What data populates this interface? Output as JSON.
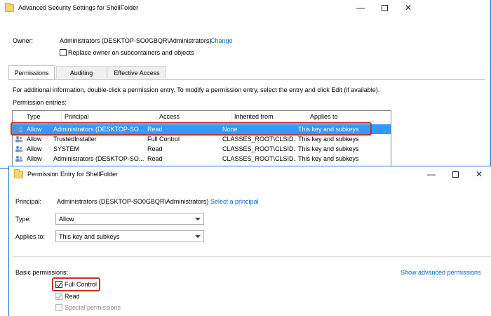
{
  "back_window": {
    "title": "Advanced Security Settings for ShellFolder",
    "owner_label": "Owner:",
    "owner_value": "Administrators (DESKTOP-SO0GBQR\\Administrators)",
    "owner_change": "Change",
    "replace_owner_label": "Replace owner on subcontainers and objects",
    "tabs": [
      "Permissions",
      "Auditing",
      "Effective Access"
    ],
    "info_text": "For additional information, double-click a permission entry. To modify a permission entry, select the entry and click Edit (if available).",
    "entries_label": "Permission entries:",
    "columns": [
      "Type",
      "Principal",
      "Access",
      "Inherited from",
      "Applies to"
    ],
    "rows": [
      {
        "type": "Allow",
        "principal": "Administrators (DESKTOP-SO...",
        "access": "Read",
        "inherited": "None",
        "applies": "This key and subkeys"
      },
      {
        "type": "Allow",
        "principal": "TrustedInstaller",
        "access": "Full Control",
        "inherited": "CLASSES_ROOT\\CLSID...",
        "applies": "This key and subkeys"
      },
      {
        "type": "Allow",
        "principal": "SYSTEM",
        "access": "Read",
        "inherited": "CLASSES_ROOT\\CLSID...",
        "applies": "This key and subkeys"
      },
      {
        "type": "Allow",
        "principal": "Administrators (DESKTOP-SO...",
        "access": "Read",
        "inherited": "CLASSES_ROOT\\CLSID...",
        "applies": "This key and subkeys"
      }
    ]
  },
  "front_window": {
    "title": "Permission Entry for ShellFolder",
    "principal_label": "Principal:",
    "principal_value": "Administrators (DESKTOP-SO0GBQR\\Administrators)",
    "select_principal": "Select a principal",
    "type_label": "Type:",
    "type_value": "Allow",
    "applies_label": "Applies to:",
    "applies_value": "This key and subkeys",
    "basic_permissions_label": "Basic permissions:",
    "show_advanced": "Show advanced permissions",
    "permissions": [
      {
        "label": "Full Control",
        "checked": true,
        "enabled": true
      },
      {
        "label": "Read",
        "checked": true,
        "enabled": false
      },
      {
        "label": "Special permissions",
        "checked": false,
        "enabled": false
      }
    ]
  },
  "colors": {
    "accent": "#1979ca",
    "selection": "#3399ff",
    "highlight_box": "#c9302c",
    "link": "#0066cc"
  }
}
